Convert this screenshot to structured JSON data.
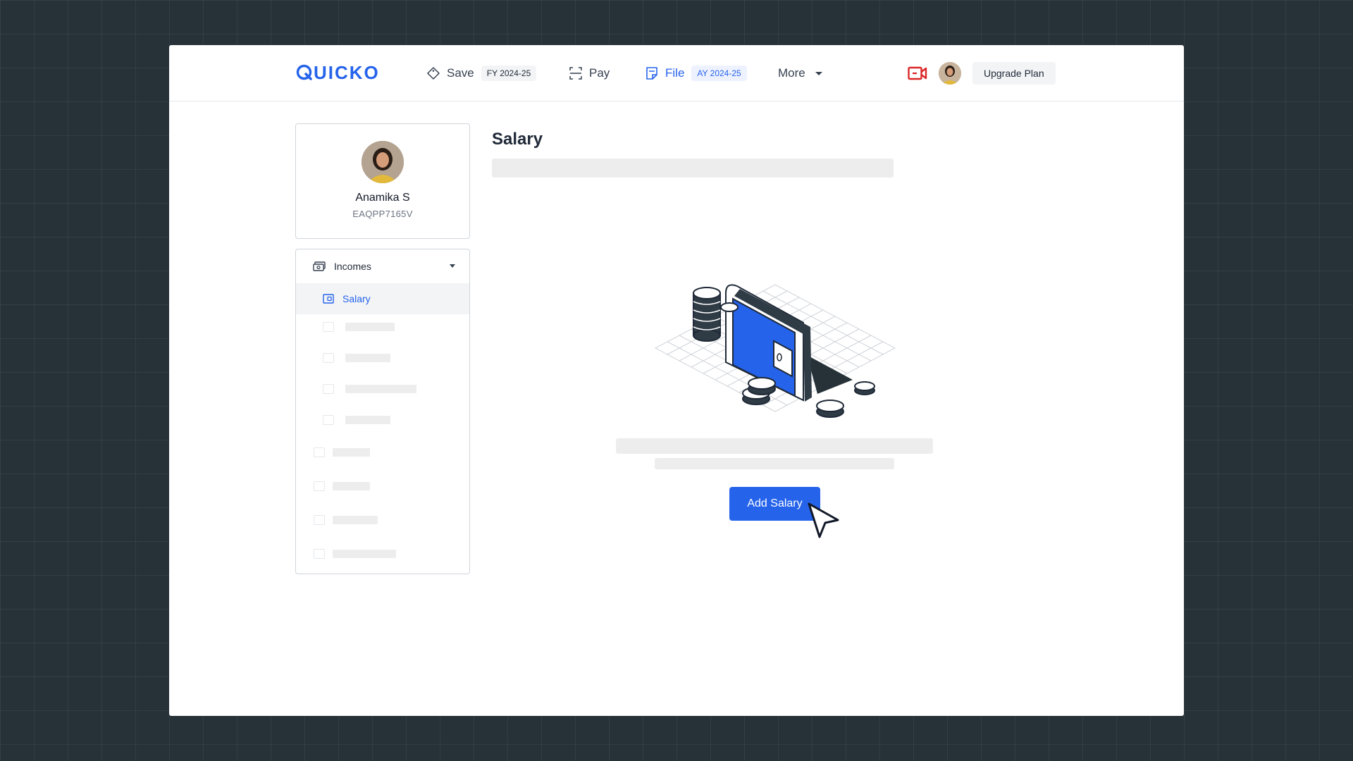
{
  "app": {
    "logo_text": "UICKO",
    "brand_color": "#2563eb"
  },
  "header": {
    "nav": [
      {
        "label": "Save",
        "chip": "FY 2024-25",
        "icon": "tag-icon"
      },
      {
        "label": "Pay",
        "icon": "scan-icon"
      },
      {
        "label": "File",
        "chip": "AY 2024-25",
        "icon": "file-icon",
        "active": true
      },
      {
        "label": "More",
        "icon": "chevron-down-icon"
      }
    ],
    "upgrade_label": "Upgrade Plan"
  },
  "profile": {
    "name": "Anamika S",
    "pan": "EAQPP7165V"
  },
  "sidebar": {
    "section_label": "Incomes",
    "active_item": "Salary"
  },
  "main": {
    "title": "Salary",
    "add_button_label": "Add Salary"
  }
}
